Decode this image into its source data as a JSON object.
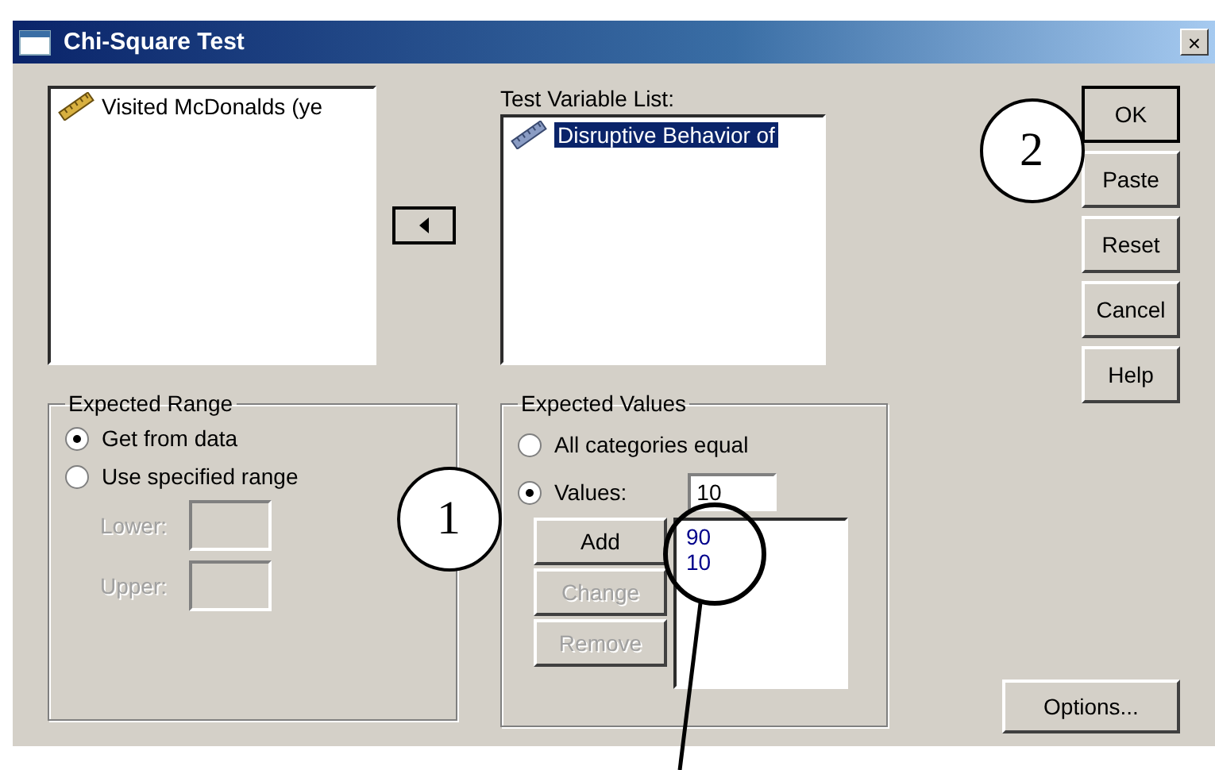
{
  "window": {
    "title": "Chi-Square Test",
    "close": "×"
  },
  "source_list": {
    "items": [
      {
        "label": "Visited McDonalds (ye",
        "selected": false
      }
    ]
  },
  "test_variable_list": {
    "label": "Test Variable List:",
    "items": [
      {
        "label": "Disruptive Behavior of",
        "selected": true
      }
    ]
  },
  "buttons": [
    {
      "label": "OK",
      "default": true
    },
    {
      "label": "Paste",
      "default": false
    },
    {
      "label": "Reset",
      "default": false
    },
    {
      "label": "Cancel",
      "default": false
    },
    {
      "label": "Help",
      "default": false
    }
  ],
  "expected_range": {
    "title": "Expected Range",
    "options": [
      {
        "label": "Get from data",
        "selected": true
      },
      {
        "label": "Use specified range",
        "selected": false
      }
    ],
    "fields": [
      {
        "label": "Lower:",
        "disabled": true
      },
      {
        "label": "Upper:",
        "disabled": true
      }
    ]
  },
  "expected_values": {
    "title": "Expected Values",
    "options": [
      {
        "label": "All categories equal",
        "selected": false
      },
      {
        "label": "Values:",
        "selected": true
      }
    ],
    "value": "10",
    "actions": [
      {
        "label": "Add",
        "disabled": false
      },
      {
        "label": "Change",
        "disabled": true
      },
      {
        "label": "Remove",
        "disabled": true
      }
    ],
    "list": [
      "90",
      "10"
    ]
  },
  "options_button": {
    "label": "Options..."
  },
  "callouts": [
    {
      "label": "1"
    },
    {
      "label": "2"
    }
  ]
}
